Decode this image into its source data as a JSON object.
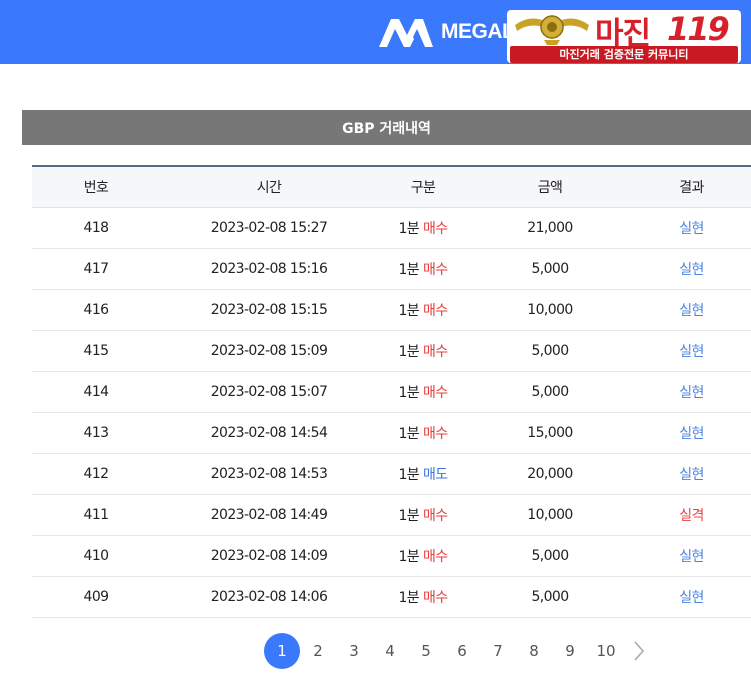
{
  "header": {
    "logo_text": "MEGALIV",
    "accent": "#3a79fb"
  },
  "watermark": {
    "brand": "마진",
    "number": "119",
    "tagline": "마진거래 검증전문 커뮤니티"
  },
  "section": {
    "title": "GBP 거래내역"
  },
  "table": {
    "columns": [
      "번호",
      "시간",
      "구분",
      "금액",
      "결과"
    ],
    "rows": [
      {
        "no": "418",
        "time": "2023-02-08 15:27",
        "period": "1분",
        "side": "매수",
        "side_type": "buy",
        "amount": "21,000",
        "result": "실현",
        "result_type": "win"
      },
      {
        "no": "417",
        "time": "2023-02-08 15:16",
        "period": "1분",
        "side": "매수",
        "side_type": "buy",
        "amount": "5,000",
        "result": "실현",
        "result_type": "win"
      },
      {
        "no": "416",
        "time": "2023-02-08 15:15",
        "period": "1분",
        "side": "매수",
        "side_type": "buy",
        "amount": "10,000",
        "result": "실현",
        "result_type": "win"
      },
      {
        "no": "415",
        "time": "2023-02-08 15:09",
        "period": "1분",
        "side": "매수",
        "side_type": "buy",
        "amount": "5,000",
        "result": "실현",
        "result_type": "win"
      },
      {
        "no": "414",
        "time": "2023-02-08 15:07",
        "period": "1분",
        "side": "매수",
        "side_type": "buy",
        "amount": "5,000",
        "result": "실현",
        "result_type": "win"
      },
      {
        "no": "413",
        "time": "2023-02-08 14:54",
        "period": "1분",
        "side": "매수",
        "side_type": "buy",
        "amount": "15,000",
        "result": "실현",
        "result_type": "win"
      },
      {
        "no": "412",
        "time": "2023-02-08 14:53",
        "period": "1분",
        "side": "매도",
        "side_type": "sell",
        "amount": "20,000",
        "result": "실현",
        "result_type": "win"
      },
      {
        "no": "411",
        "time": "2023-02-08 14:49",
        "period": "1분",
        "side": "매수",
        "side_type": "buy",
        "amount": "10,000",
        "result": "실격",
        "result_type": "loss"
      },
      {
        "no": "410",
        "time": "2023-02-08 14:09",
        "period": "1분",
        "side": "매수",
        "side_type": "buy",
        "amount": "5,000",
        "result": "실현",
        "result_type": "win"
      },
      {
        "no": "409",
        "time": "2023-02-08 14:06",
        "period": "1분",
        "side": "매수",
        "side_type": "buy",
        "amount": "5,000",
        "result": "실현",
        "result_type": "win"
      }
    ]
  },
  "pagination": {
    "pages": [
      "1",
      "2",
      "3",
      "4",
      "5",
      "6",
      "7",
      "8",
      "9",
      "10"
    ],
    "current": "1",
    "next_icon": "chevron-right-icon"
  }
}
